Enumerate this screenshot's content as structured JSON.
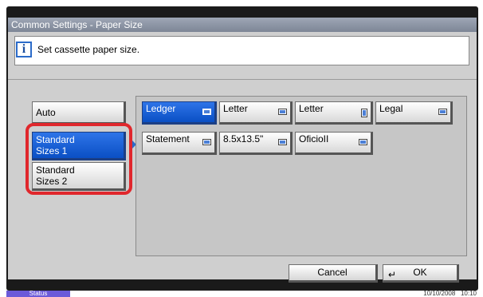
{
  "window": {
    "title": "Common Settings - Paper Size"
  },
  "message": {
    "text": "Set cassette paper size.",
    "icon": "info-icon"
  },
  "categories": [
    {
      "label": "Auto",
      "selected": false
    },
    {
      "label": "Standard\nSizes 1",
      "selected": true
    },
    {
      "label": "Standard\nSizes 2",
      "selected": false
    }
  ],
  "sizes": [
    {
      "label": "Ledger",
      "orientation": "landscape",
      "selected": true
    },
    {
      "label": "Letter",
      "orientation": "landscape",
      "selected": false
    },
    {
      "label": "Letter",
      "orientation": "portrait",
      "selected": false
    },
    {
      "label": "Legal",
      "orientation": "landscape",
      "selected": false
    },
    {
      "label": "Statement",
      "orientation": "landscape",
      "selected": false
    },
    {
      "label": "8.5x13.5\"",
      "orientation": "landscape",
      "selected": false
    },
    {
      "label": "OficioII",
      "orientation": "landscape",
      "selected": false
    }
  ],
  "actions": {
    "cancel": "Cancel",
    "ok": "OK"
  },
  "status": {
    "label": "Status",
    "date": "10/10/2008",
    "time": "10:10"
  },
  "colors": {
    "accent": "#0a4fc4",
    "highlight": "#e0272c",
    "status": "#6b5ad9"
  }
}
